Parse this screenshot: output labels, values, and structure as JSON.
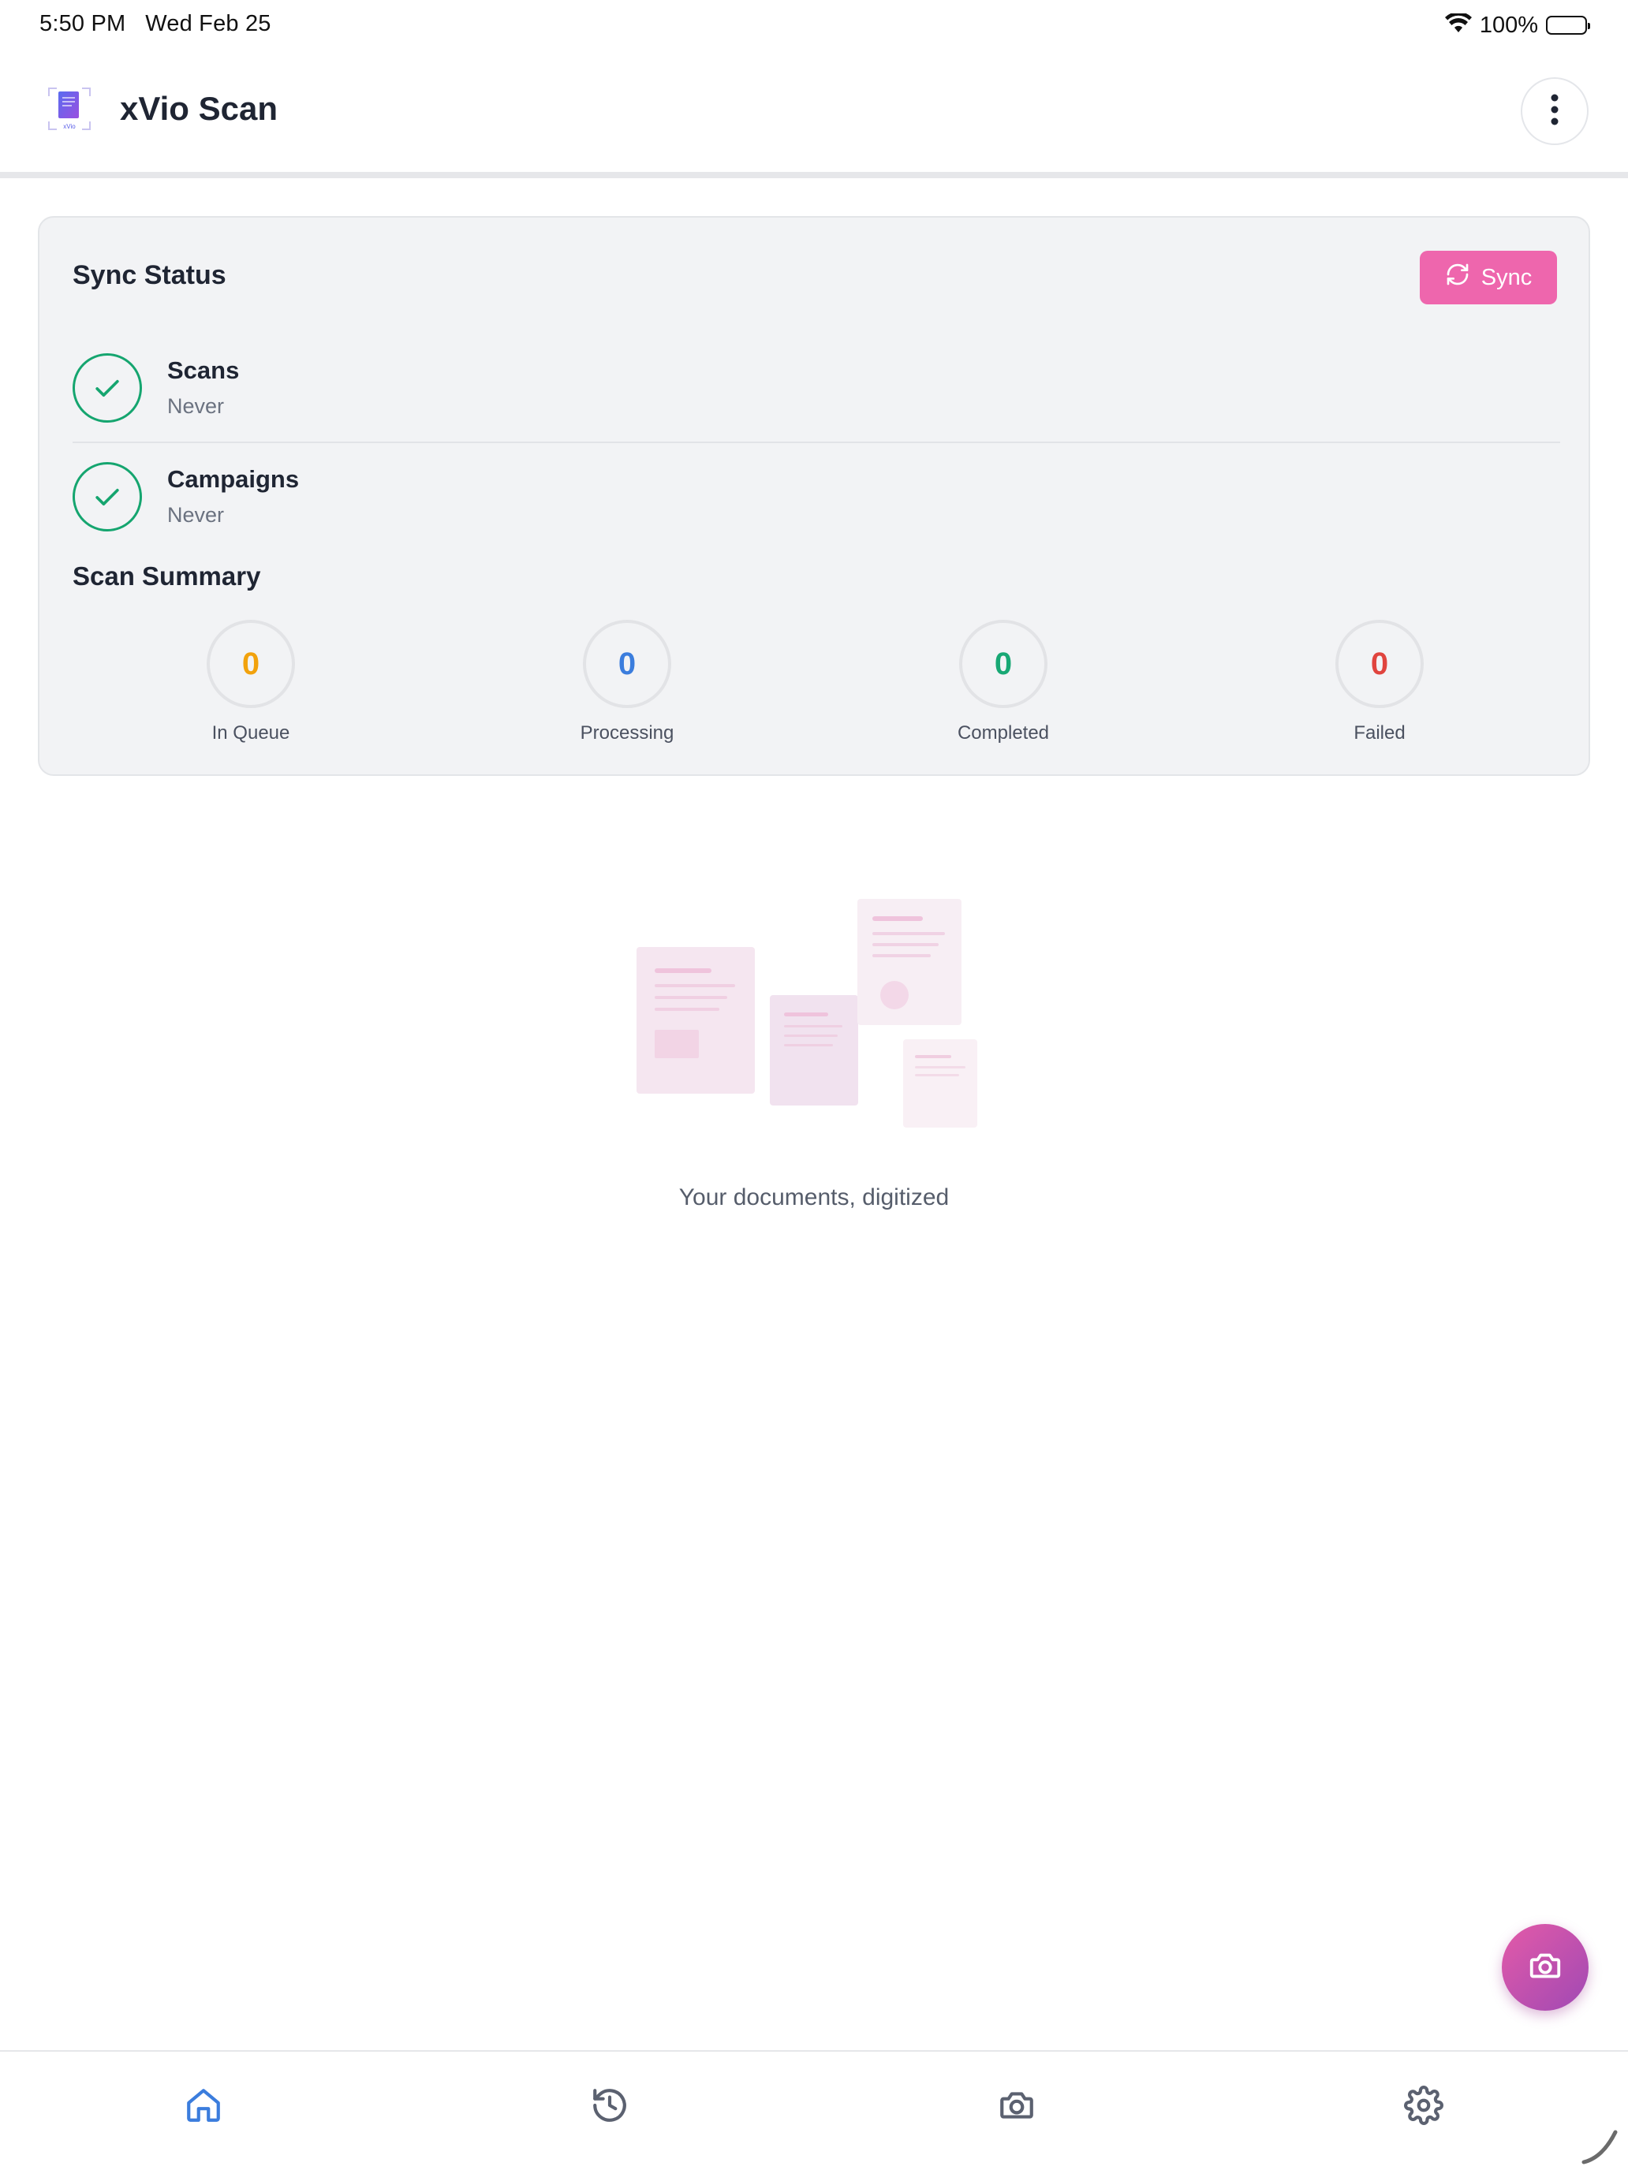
{
  "status_bar": {
    "time": "5:50 PM",
    "date": "Wed Feb 25",
    "battery": "100%"
  },
  "header": {
    "title": "xVio Scan",
    "logo_text": "xVio",
    "menu_icon": "more-vertical-icon"
  },
  "sync_status": {
    "title": "Sync Status",
    "sync_button_label": "Sync",
    "rows": [
      {
        "label": "Scans",
        "value": "Never"
      },
      {
        "label": "Campaigns",
        "value": "Never"
      }
    ]
  },
  "scan_summary": {
    "title": "Scan Summary",
    "stats": [
      {
        "value": "0",
        "label": "In Queue",
        "color": "#f2a20c"
      },
      {
        "value": "0",
        "label": "Processing",
        "color": "#3b7ddd"
      },
      {
        "value": "0",
        "label": "Completed",
        "color": "#18a874"
      },
      {
        "value": "0",
        "label": "Failed",
        "color": "#e0443e"
      }
    ]
  },
  "empty_state": {
    "caption": "Your documents, digitized"
  },
  "fab": {
    "icon": "camera-icon"
  },
  "bottom_nav": {
    "items": [
      {
        "icon": "home-icon",
        "active": true
      },
      {
        "icon": "history-icon",
        "active": false
      },
      {
        "icon": "camera-icon",
        "active": false
      },
      {
        "icon": "settings-icon",
        "active": false
      }
    ]
  },
  "colors": {
    "accent": "#ee66ad",
    "success": "#15a56f",
    "active_nav": "#3b7ddd"
  }
}
